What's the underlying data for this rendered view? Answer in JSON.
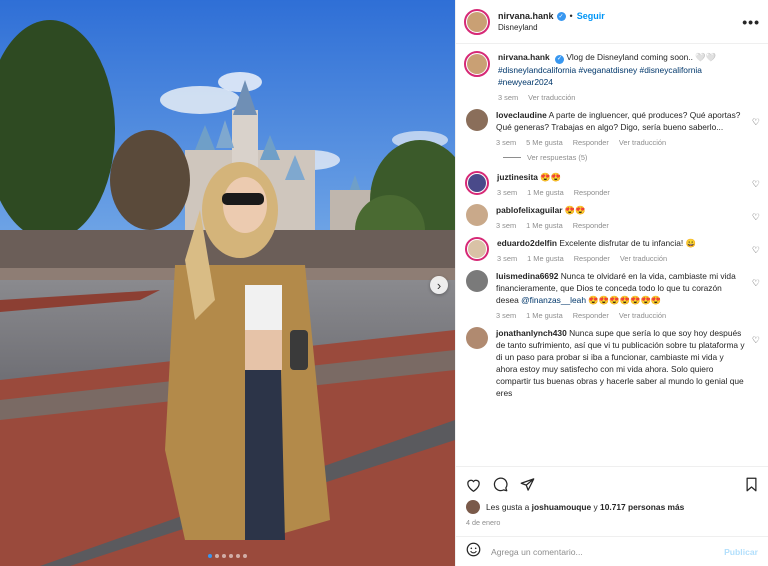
{
  "post": {
    "username": "nirvana.hank",
    "follow_label": "Seguir",
    "separator": "•",
    "location": "Disneyland",
    "more_label": "•••",
    "photo": {
      "carousel_total": 6,
      "carousel_index": 0,
      "next_arrow": "›"
    }
  },
  "caption": {
    "username": "nirvana.hank",
    "text": "Vlog de Disneyland coming soon.. 🤍🤍",
    "hashtags": "#disneylandcalifornia #veganatdisney #disneycalifornia #newyear2024",
    "time": "3 sem",
    "translate": "Ver traducción"
  },
  "comments": [
    {
      "username": "loveclaudine",
      "text": "A parte de ingluencer, qué produces? Qué aportas? Qué generas? Trabajas en algo? Digo, sería bueno saberlo...",
      "time": "3 sem",
      "likes": "5 Me gusta",
      "reply": "Responder",
      "translate": "Ver traducción",
      "replies_label": "Ver respuestas (5)",
      "avatar_color": "#8a6e5a"
    },
    {
      "username": "juztinesita",
      "text": "",
      "emojis": [
        "😍",
        "😍"
      ],
      "time": "3 sem",
      "likes": "1 Me gusta",
      "reply": "Responder",
      "avatar_color": "#4a4a8a"
    },
    {
      "username": "pablofelixaguilar",
      "text": "",
      "emojis": [
        "😍",
        "😍"
      ],
      "time": "3 sem",
      "likes": "1 Me gusta",
      "reply": "Responder",
      "avatar_color": "#c9a98a"
    },
    {
      "username": "eduardo2delfin",
      "text": "Excelente disfrutar de tu infancia! 😀",
      "time": "3 sem",
      "likes": "1 Me gusta",
      "reply": "Responder",
      "translate": "Ver traducción",
      "avatar_color": "#d9c2a6"
    },
    {
      "username": "luismedina6692",
      "text": "Nunca te olvidaré en la vida, cambiaste mi vida financieramente, que Dios te conceda todo lo que tu corazón desea",
      "mention": "@finanzas__leah",
      "emoji_tail": "😍😍😍😍😍😍😍",
      "time": "3 sem",
      "likes": "1 Me gusta",
      "reply": "Responder",
      "translate": "Ver traducción",
      "avatar_color": "#7a7a7a"
    },
    {
      "username": "jonathanlynch430",
      "text": "Nunca supe que sería lo que soy hoy después de tanto sufrimiento, así que vi tu publicación sobre tu plataforma y di un paso para probar si iba a funcionar, cambiaste mi vida y ahora estoy muy satisfecho con mi vida ahora. Solo quiero compartir tus buenas obras y hacerle saber al mundo lo genial que eres",
      "time": "",
      "avatar_color": "#b08a70"
    }
  ],
  "footer": {
    "liked_by_prefix": "Les gusta a",
    "liked_by_user": "joshuamouque",
    "liked_by_conj": "y",
    "liked_by_count": "10.717 personas más",
    "date": "4 de enero",
    "comment_placeholder": "Agrega un comentario...",
    "publish_label": "Publicar"
  },
  "colors": {
    "accent": "#0095f6",
    "verified": "#3897f0",
    "muted": "#8e8e8e",
    "story_ring": "#d62976"
  },
  "icons": [
    "heart-icon",
    "comment-icon",
    "share-icon",
    "bookmark-icon",
    "emoji-icon",
    "verified-icon",
    "more-icon",
    "chevron-right-icon"
  ]
}
